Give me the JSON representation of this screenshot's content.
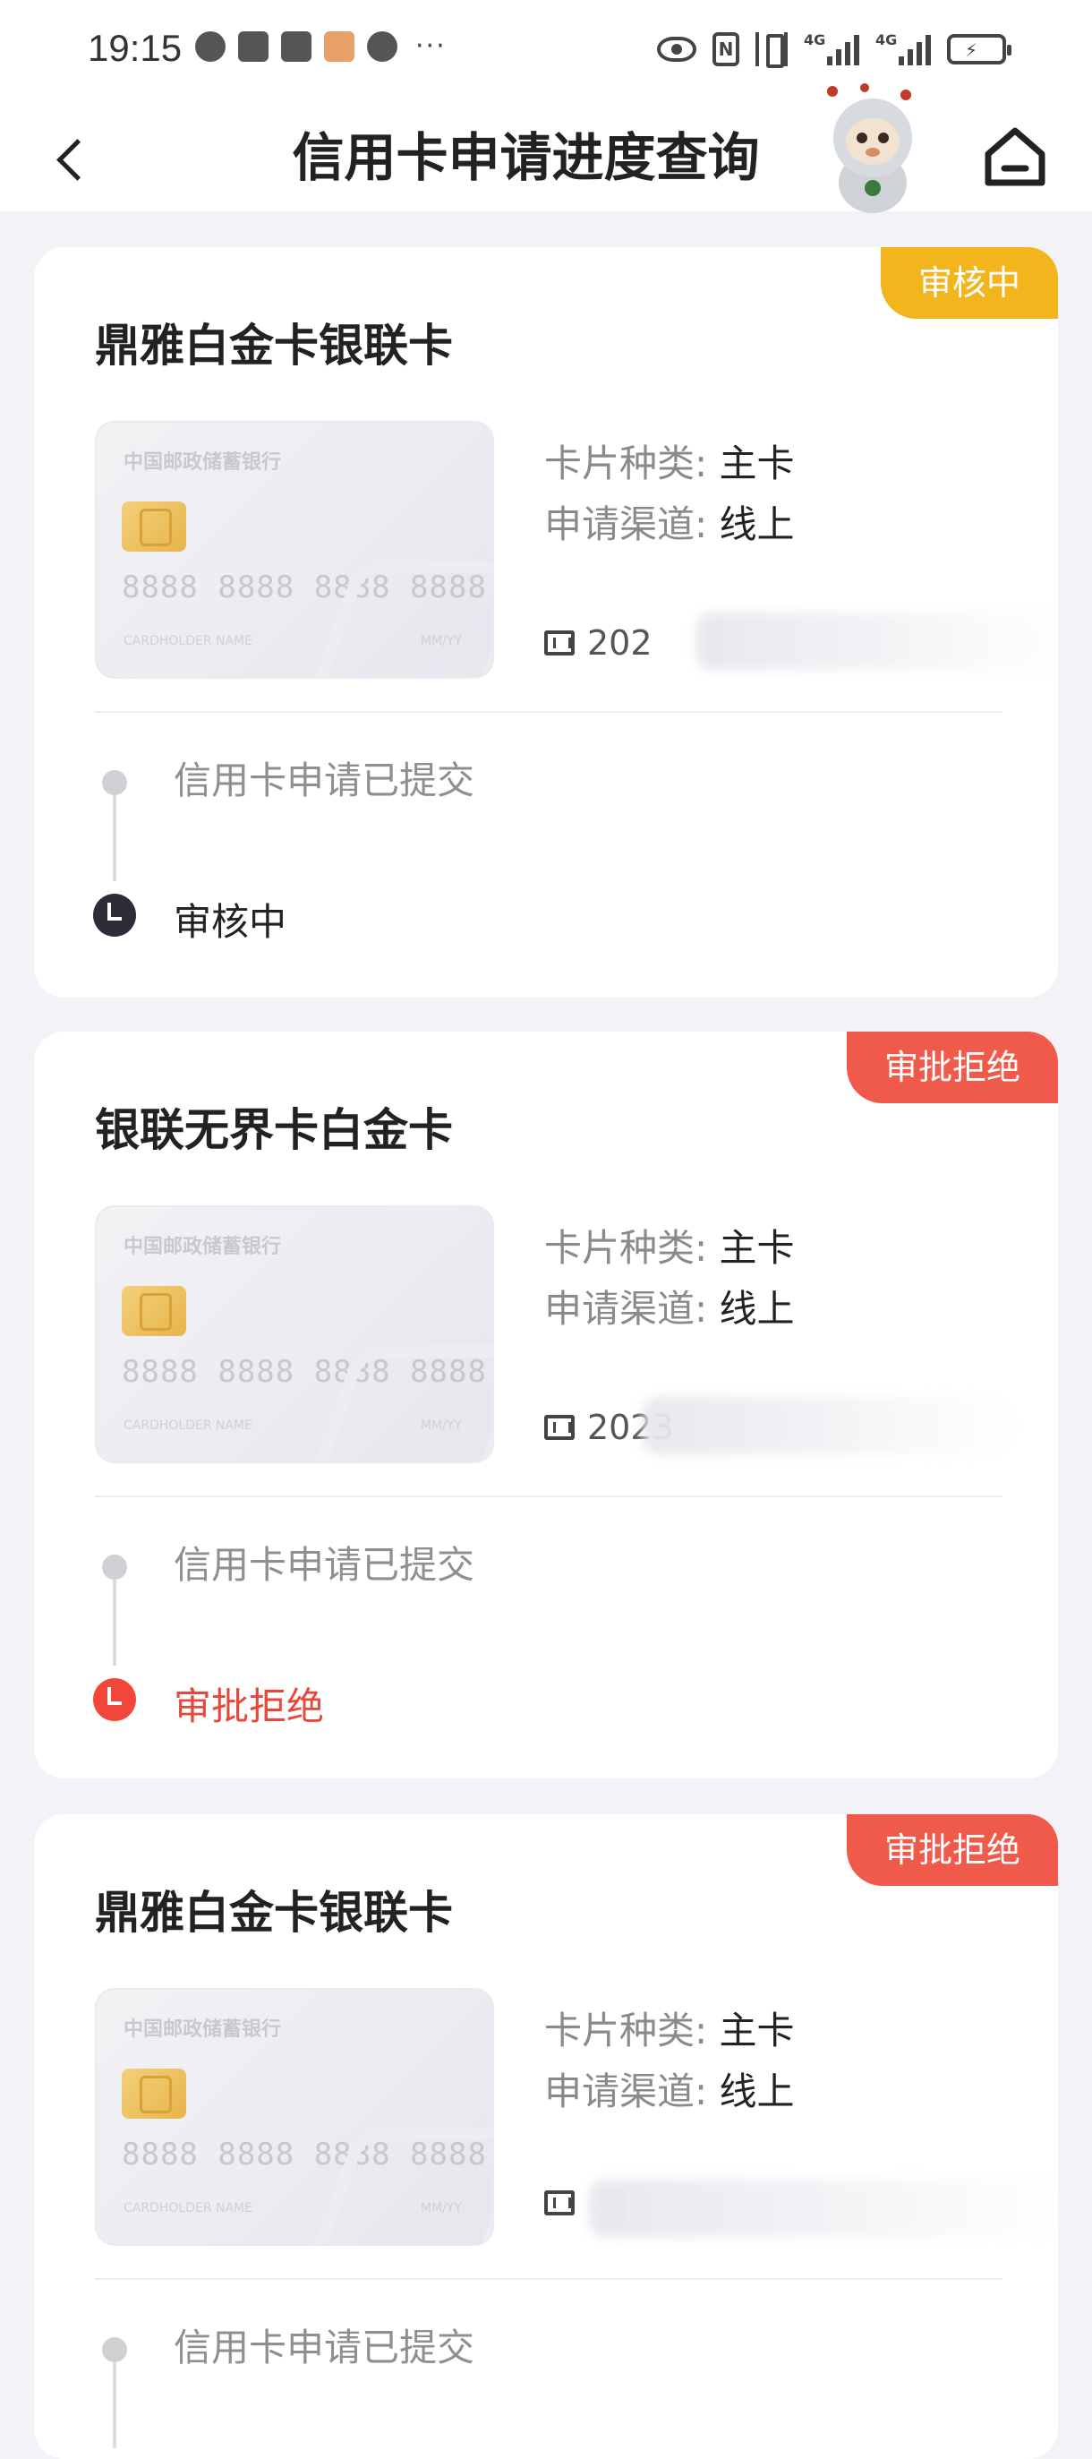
{
  "status_bar": {
    "time": "19:15",
    "more": "···",
    "signal_tag_1": "4G",
    "signal_tag_2": "4G"
  },
  "nav": {
    "title": "信用卡申请进度查询"
  },
  "cards": [
    {
      "name": "鼎雅白金卡银联卡",
      "badge": "审核中",
      "badge_color": "#f2b51e",
      "card_type_label": "卡片种类:",
      "card_type_value": "主卡",
      "channel_label": "申请渠道:",
      "channel_value": "线上",
      "application_no": "202",
      "image": {
        "bank": "中国邮政储蓄银行",
        "number": "8888 8888 8888 8888",
        "holder": "CARDHOLDER NAME",
        "expiry": "MM/YY"
      },
      "step1": "信用卡申请已提交",
      "step2": "审核中",
      "step2_status": "dark"
    },
    {
      "name": "银联无界卡白金卡",
      "badge": "审批拒绝",
      "badge_color": "#f05a4a",
      "card_type_label": "卡片种类:",
      "card_type_value": "主卡",
      "channel_label": "申请渠道:",
      "channel_value": "线上",
      "application_no": "2023",
      "image": {
        "bank": "中国邮政储蓄银行",
        "number": "8888 8888 8888 8888",
        "holder": "CARDHOLDER NAME",
        "expiry": "MM/YY"
      },
      "step1": "信用卡申请已提交",
      "step2": "审批拒绝",
      "step2_status": "red"
    },
    {
      "name": "鼎雅白金卡银联卡",
      "badge": "审批拒绝",
      "badge_color": "#f05a4a",
      "card_type_label": "卡片种类:",
      "card_type_value": "主卡",
      "channel_label": "申请渠道:",
      "channel_value": "线上",
      "application_no": "",
      "image": {
        "bank": "中国邮政储蓄银行",
        "number": "8888 8888 8888 8888",
        "holder": "CARDHOLDER NAME",
        "expiry": "MM/YY"
      },
      "step1": "信用卡申请已提交",
      "step2": "",
      "step2_status": "none"
    }
  ]
}
